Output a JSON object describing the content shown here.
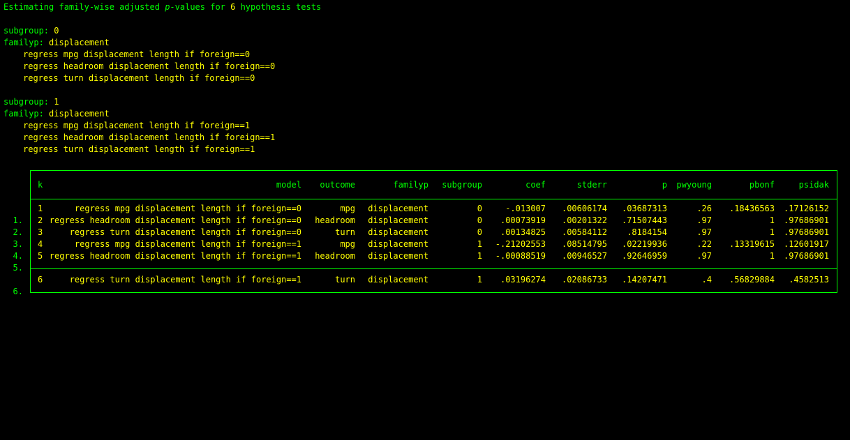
{
  "log": {
    "heading_pre": "Estimating family-wise adjusted ",
    "heading_p": "p",
    "heading_mid": "-values for ",
    "heading_count": "6",
    "heading_post": " hypothesis tests",
    "blocks": [
      {
        "subgroup_label": "subgroup:",
        "subgroup_value": "0",
        "familyp_label": "familyp:",
        "familyp_value": "displacement",
        "commands": [
          "regress mpg displacement length if foreign==0",
          "regress headroom displacement length if foreign==0",
          "regress turn displacement length if foreign==0"
        ]
      },
      {
        "subgroup_label": "subgroup:",
        "subgroup_value": "1",
        "familyp_label": "familyp:",
        "familyp_value": "displacement",
        "commands": [
          "regress mpg displacement length if foreign==1",
          "regress headroom displacement length if foreign==1",
          "regress turn displacement length if foreign==1"
        ]
      }
    ]
  },
  "table": {
    "headers": {
      "k": "k",
      "model": "model",
      "outcome": "outcome",
      "familyp": "familyp",
      "subgroup": "subgroup",
      "coef": "coef",
      "stderr": "stderr",
      "p": "p",
      "pwyoung": "pwyoung",
      "pbonf": "pbonf",
      "psidak": "psidak"
    },
    "rows": [
      {
        "num": "1.",
        "k": "1",
        "model": "regress mpg displacement length if foreign==0",
        "outcome": "mpg",
        "familyp": "displacement",
        "subgroup": "0",
        "coef": "-.013007",
        "stderr": ".00606174",
        "p": ".03687313",
        "pwyoung": ".26",
        "pbonf": ".18436563",
        "psidak": ".17126152"
      },
      {
        "num": "2.",
        "k": "2",
        "model": "regress headroom displacement length if foreign==0",
        "outcome": "headroom",
        "familyp": "displacement",
        "subgroup": "0",
        "coef": ".00073919",
        "stderr": ".00201322",
        "p": ".71507443",
        "pwyoung": ".97",
        "pbonf": "1",
        "psidak": ".97686901"
      },
      {
        "num": "3.",
        "k": "3",
        "model": "regress turn displacement length if foreign==0",
        "outcome": "turn",
        "familyp": "displacement",
        "subgroup": "0",
        "coef": ".00134825",
        "stderr": ".00584112",
        "p": ".8184154",
        "pwyoung": ".97",
        "pbonf": "1",
        "psidak": ".97686901"
      },
      {
        "num": "4.",
        "k": "4",
        "model": "regress mpg displacement length if foreign==1",
        "outcome": "mpg",
        "familyp": "displacement",
        "subgroup": "1",
        "coef": "-.21202553",
        "stderr": ".08514795",
        "p": ".02219936",
        "pwyoung": ".22",
        "pbonf": ".13319615",
        "psidak": ".12601917"
      },
      {
        "num": "5.",
        "k": "5",
        "model": "regress headroom displacement length if foreign==1",
        "outcome": "headroom",
        "familyp": "displacement",
        "subgroup": "1",
        "coef": "-.00088519",
        "stderr": ".00946527",
        "p": ".92646959",
        "pwyoung": ".97",
        "pbonf": "1",
        "psidak": ".97686901"
      },
      {
        "num": "6.",
        "k": "6",
        "model": "regress turn displacement length if foreign==1",
        "outcome": "turn",
        "familyp": "displacement",
        "subgroup": "1",
        "coef": ".03196274",
        "stderr": ".02086733",
        "p": ".14207471",
        "pwyoung": ".4",
        "pbonf": ".56829884",
        "psidak": ".4582513"
      }
    ]
  },
  "colors": {
    "background": "#000000",
    "label": "#00ff00",
    "value": "#ffff00",
    "border": "#00ff00"
  }
}
